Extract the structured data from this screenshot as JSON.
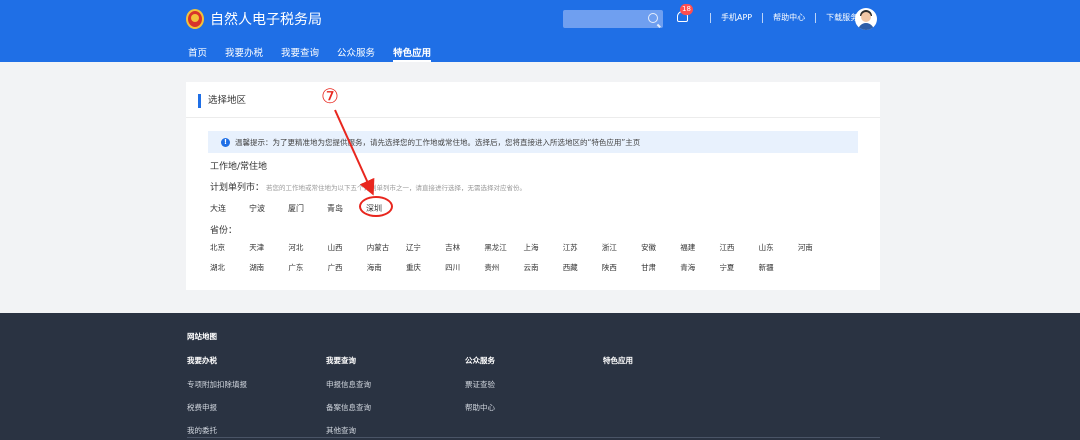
{
  "header": {
    "site_title": "自然人电子税务局",
    "notification_count": "18",
    "links": [
      "手机APP",
      "帮助中心",
      "下载服务"
    ]
  },
  "nav": {
    "items": [
      "首页",
      "我要办税",
      "我要查询",
      "公众服务",
      "特色应用"
    ],
    "active": "特色应用"
  },
  "card": {
    "title": "选择地区",
    "notice": "温馨提示：为了更精准地为您提供服务，请先选择您的工作地或常住地。选择后，您将直接进入所选地区的“特色应用”主页",
    "work_label": "工作地/常住地",
    "plan_label": "计划单列市：",
    "plan_hint": "若您的工作地或常住地为以下五个计划单列市之一，请直接进行选择，无需选择对应省份。",
    "cities": [
      "大连",
      "宁波",
      "厦门",
      "青岛",
      "深圳"
    ],
    "province_label": "省份：",
    "provinces_row1": [
      "北京",
      "天津",
      "河北",
      "山西",
      "内蒙古",
      "辽宁",
      "吉林",
      "黑龙江",
      "上海",
      "江苏",
      "浙江",
      "安徽",
      "福建",
      "江西",
      "山东",
      "河南"
    ],
    "provinces_row2": [
      "湖北",
      "湖南",
      "广东",
      "广西",
      "海南",
      "重庆",
      "四川",
      "贵州",
      "云南",
      "西藏",
      "陕西",
      "甘肃",
      "青海",
      "宁夏",
      "新疆"
    ]
  },
  "annotation": {
    "step_number": "⑦",
    "highlight_color": "#e8261e"
  },
  "footer": {
    "title": "网站地图",
    "columns": [
      {
        "head": "我要办税",
        "links": [
          "专项附加扣除填报",
          "税费申报",
          "我的委托"
        ]
      },
      {
        "head": "我要查询",
        "links": [
          "申报信息查询",
          "备案信息查询",
          "其他查询"
        ]
      },
      {
        "head": "公众服务",
        "links": [
          "票证查验",
          "帮助中心"
        ]
      },
      {
        "head": "特色应用",
        "links": []
      }
    ]
  },
  "colors": {
    "brand_blue": "#1f6fe6",
    "footer_bg": "#2a3342",
    "notice_bg": "#e8f1fd"
  }
}
